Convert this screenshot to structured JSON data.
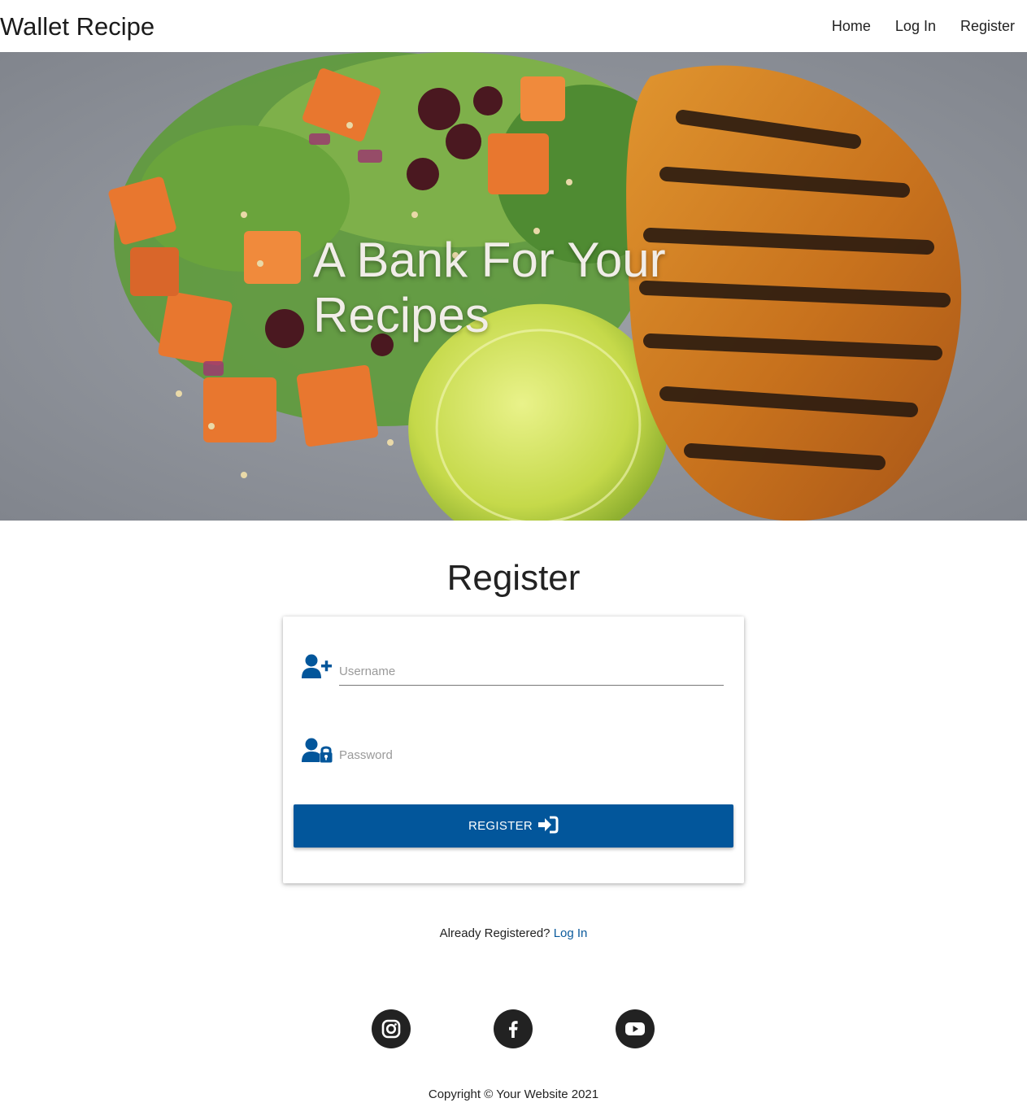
{
  "navbar": {
    "brand": "Wallet Recipe",
    "links": [
      "Home",
      "Log In",
      "Register"
    ]
  },
  "hero": {
    "title_line1": "A Bank For Your",
    "title_line2": "Recipes"
  },
  "register": {
    "title": "Register",
    "username_placeholder": "Username",
    "password_placeholder": "Password",
    "button_label": "REGISTER",
    "already_text": "Already Registered?",
    "login_link": "Log In"
  },
  "footer": {
    "social": [
      "instagram-icon",
      "facebook-icon",
      "youtube-icon"
    ],
    "copyright": "Copyright © Your Website 2021"
  },
  "colors": {
    "primary": "#02569b",
    "link": "#0a5a9c",
    "social_bg": "#222222"
  }
}
